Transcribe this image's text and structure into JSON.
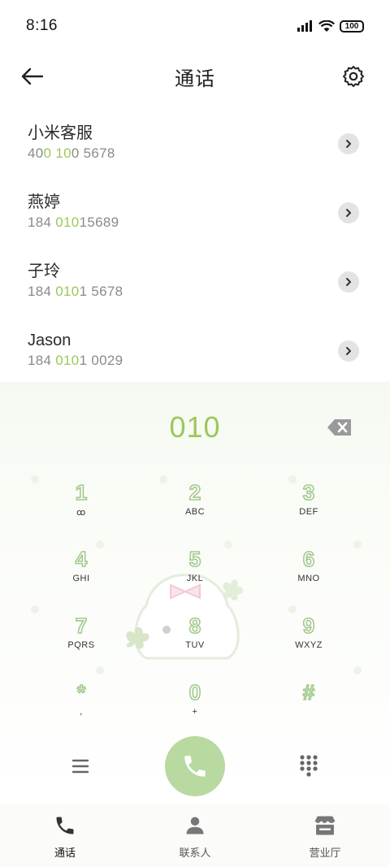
{
  "status_bar": {
    "time": "8:16",
    "battery": "100"
  },
  "header": {
    "title": "通话"
  },
  "contacts": [
    {
      "name": "小米客服",
      "number_parts": [
        "40",
        "0",
        " ",
        "10",
        "0 5678"
      ]
    },
    {
      "name": "燕婷",
      "number_parts": [
        "184 ",
        "010",
        "15689",
        "",
        ""
      ]
    },
    {
      "name": "子玲",
      "number_parts": [
        "184 ",
        "010",
        "1 5678",
        "",
        ""
      ]
    },
    {
      "name": "Jason",
      "number_parts": [
        "184 ",
        "010",
        "1 0029",
        "",
        ""
      ]
    }
  ],
  "dialer": {
    "input": "010"
  },
  "keys": [
    {
      "digit": "1",
      "letters": "ꝏ"
    },
    {
      "digit": "2",
      "letters": "ABC"
    },
    {
      "digit": "3",
      "letters": "DEF"
    },
    {
      "digit": "4",
      "letters": "GHI"
    },
    {
      "digit": "5",
      "letters": "JKL"
    },
    {
      "digit": "6",
      "letters": "MNO"
    },
    {
      "digit": "7",
      "letters": "PQRS"
    },
    {
      "digit": "8",
      "letters": "TUV"
    },
    {
      "digit": "9",
      "letters": "WXYZ"
    },
    {
      "digit": "*",
      "letters": ","
    },
    {
      "digit": "0",
      "letters": "+"
    },
    {
      "digit": "#",
      "letters": ""
    }
  ],
  "bottom_nav": {
    "items": [
      {
        "label": "通话",
        "icon": "phone-icon",
        "active": true
      },
      {
        "label": "联系人",
        "icon": "person-icon",
        "active": false
      },
      {
        "label": "营业厅",
        "icon": "store-icon",
        "active": false
      }
    ]
  },
  "colors": {
    "accent": "#9bc85a",
    "call_button": "#b8d99f",
    "digit_outline": "#a3c98d"
  }
}
